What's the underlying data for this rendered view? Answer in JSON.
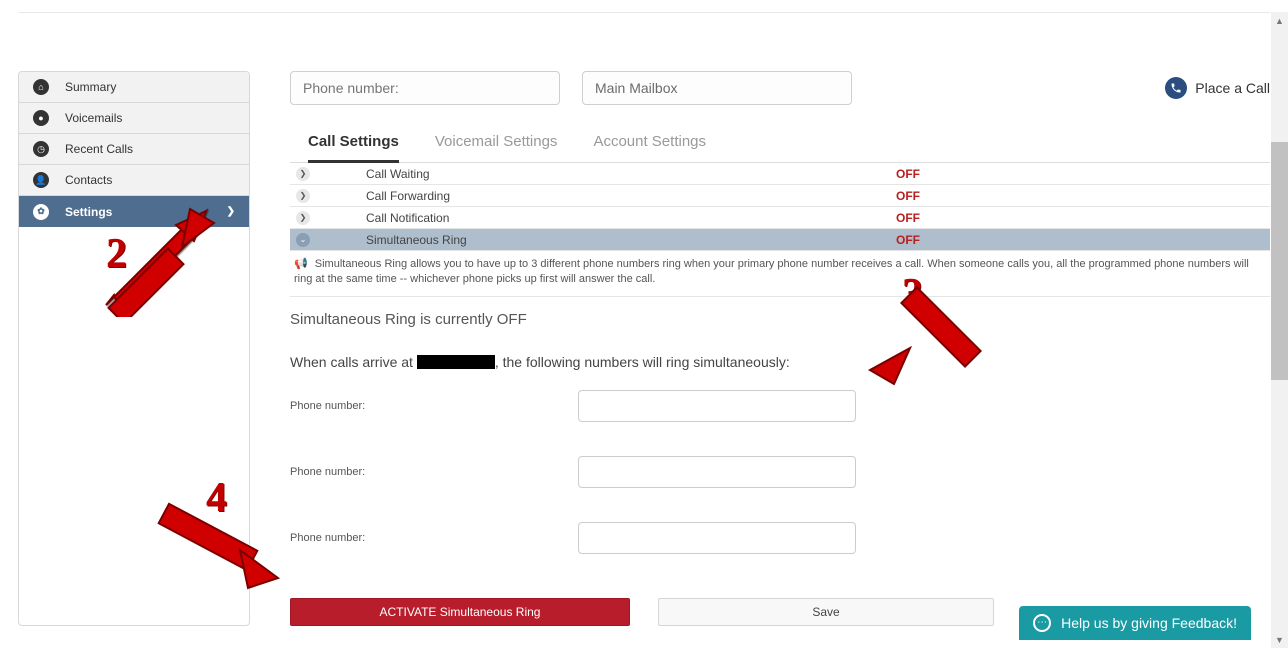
{
  "sidebar": {
    "items": [
      {
        "label": "Summary",
        "icon_name": "home-icon"
      },
      {
        "label": "Voicemails",
        "icon_name": "voicemail-icon"
      },
      {
        "label": "Recent Calls",
        "icon_name": "clock-icon"
      },
      {
        "label": "Contacts",
        "icon_name": "user-icon"
      },
      {
        "label": "Settings",
        "icon_name": "gear-icon",
        "active": true
      }
    ]
  },
  "header": {
    "phone_placeholder": "Phone number:",
    "mailbox_value": "Main Mailbox",
    "place_call_label": "Place a Call"
  },
  "tabs": [
    {
      "label": "Call Settings",
      "active": true
    },
    {
      "label": "Voicemail Settings",
      "active": false
    },
    {
      "label": "Account Settings",
      "active": false
    }
  ],
  "settings_rows": [
    {
      "name": "Call Waiting",
      "status": "OFF",
      "expanded": false
    },
    {
      "name": "Call Forwarding",
      "status": "OFF",
      "expanded": false
    },
    {
      "name": "Call Notification",
      "status": "OFF",
      "expanded": false
    },
    {
      "name": "Simultaneous Ring",
      "status": "OFF",
      "expanded": true
    }
  ],
  "help_text": "Simultaneous Ring allows you to have up to 3 different phone numbers ring when your primary phone number receives a call. When someone calls you, all the programmed phone numbers will ring at the same time -- whichever phone picks up first will answer the call.",
  "panel": {
    "status_line": "Simultaneous Ring is currently OFF",
    "instruction_prefix": "When calls arrive at ",
    "instruction_suffix": ", the following numbers will ring simultaneously:",
    "phone_label": "Phone number:",
    "activate_label": "ACTIVATE Simultaneous Ring",
    "save_label": "Save"
  },
  "feedback": {
    "label": "Help us by giving Feedback!"
  },
  "annotations": {
    "n2": "2",
    "n3": "3",
    "n4": "4"
  }
}
